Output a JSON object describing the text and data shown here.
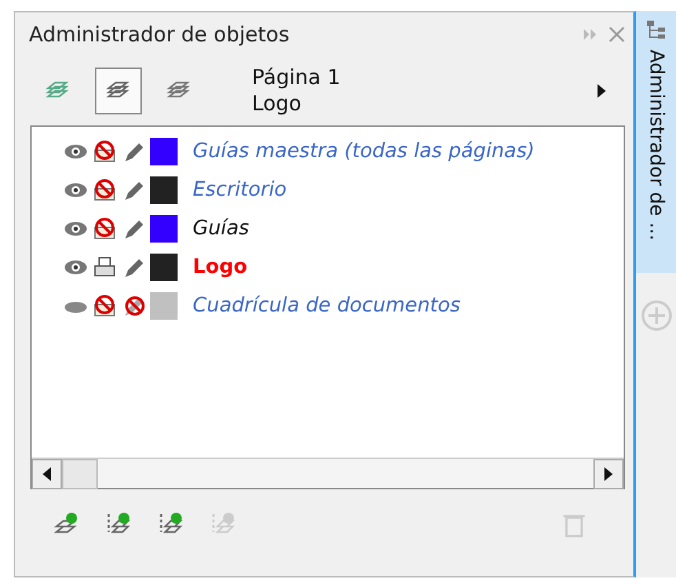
{
  "window": {
    "title": "Administrador de objetos"
  },
  "toolbar": {
    "buttons": [
      {
        "kind": "show-properties",
        "selected": false
      },
      {
        "kind": "edit-across-layers",
        "selected": true
      },
      {
        "kind": "layer-view",
        "selected": false
      }
    ],
    "page": "Página 1",
    "layer": "Logo"
  },
  "layers": [
    {
      "name": "Guías maestra (todas las páginas)",
      "kind": "master",
      "active": false,
      "visible": true,
      "printable": false,
      "editable": true,
      "color": "#3300ff"
    },
    {
      "name": "Escritorio",
      "kind": "master",
      "active": false,
      "visible": true,
      "printable": false,
      "editable": true,
      "color": "#222222"
    },
    {
      "name": "Guías",
      "kind": "guides",
      "active": false,
      "visible": true,
      "printable": false,
      "editable": true,
      "color": "#3300ff"
    },
    {
      "name": "Logo",
      "kind": "layer",
      "active": true,
      "visible": true,
      "printable": true,
      "editable": true,
      "color": "#222222"
    },
    {
      "name": "Cuadrícula de documentos",
      "kind": "master",
      "active": false,
      "visible": false,
      "printable": false,
      "editable": false,
      "color": "#c0c0c0"
    }
  ],
  "bottom_buttons": [
    {
      "kind": "new-layer",
      "disabled": false
    },
    {
      "kind": "new-master-all",
      "disabled": false
    },
    {
      "kind": "new-master-odd",
      "disabled": false
    },
    {
      "kind": "new-master-even",
      "disabled": true
    },
    {
      "kind": "delete",
      "disabled": true
    }
  ],
  "side_tab": {
    "label": "Administrador de ..."
  }
}
